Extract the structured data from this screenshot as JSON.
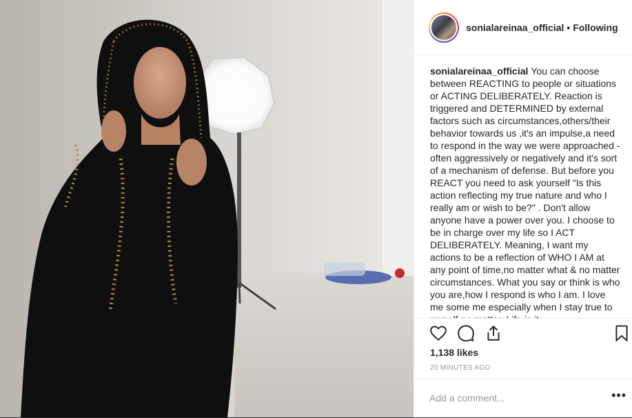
{
  "post": {
    "username": "sonialareinaa_official",
    "separator": "•",
    "follow_status": "Following",
    "caption_username": "sonialareinaa_official",
    "caption_text": "You can choose between REACTING to people or situations or ACTING DELIBERATELY. Reaction is triggered and DETERMINED by external factors such as circumstances,others/their behavior towards us ,it's an impulse,a need to respond in the way we were approached - often aggressively or negatively and it's sort of a mechanism of defense. But before you REACT you need to ask yourself \"Is this action reflecting my true nature and who I really am or wish to be?\" . Don't allow anyone have a power over you. I choose to be in charge over my life so I ACT DELIBERATELY. Meaning, I want my actions to be a reflection of WHO I AM at any point of time,no matter what & no matter circumstances. What you say or think is who you are,how I respond is who I am. I love me some me especially when I stay true to myself no matter. Life is it.",
    "likes": "1,138 likes",
    "timestamp": "20 MINUTES AGO",
    "comment_placeholder": "Add a comment...",
    "more_label": "•••"
  },
  "icons": {
    "like": "heart-icon",
    "comment": "comment-icon",
    "share": "share-icon",
    "save": "bookmark-icon"
  },
  "colors": {
    "text": "#262626",
    "muted": "#999999",
    "divider": "#efefef",
    "background": "#ffffff"
  }
}
